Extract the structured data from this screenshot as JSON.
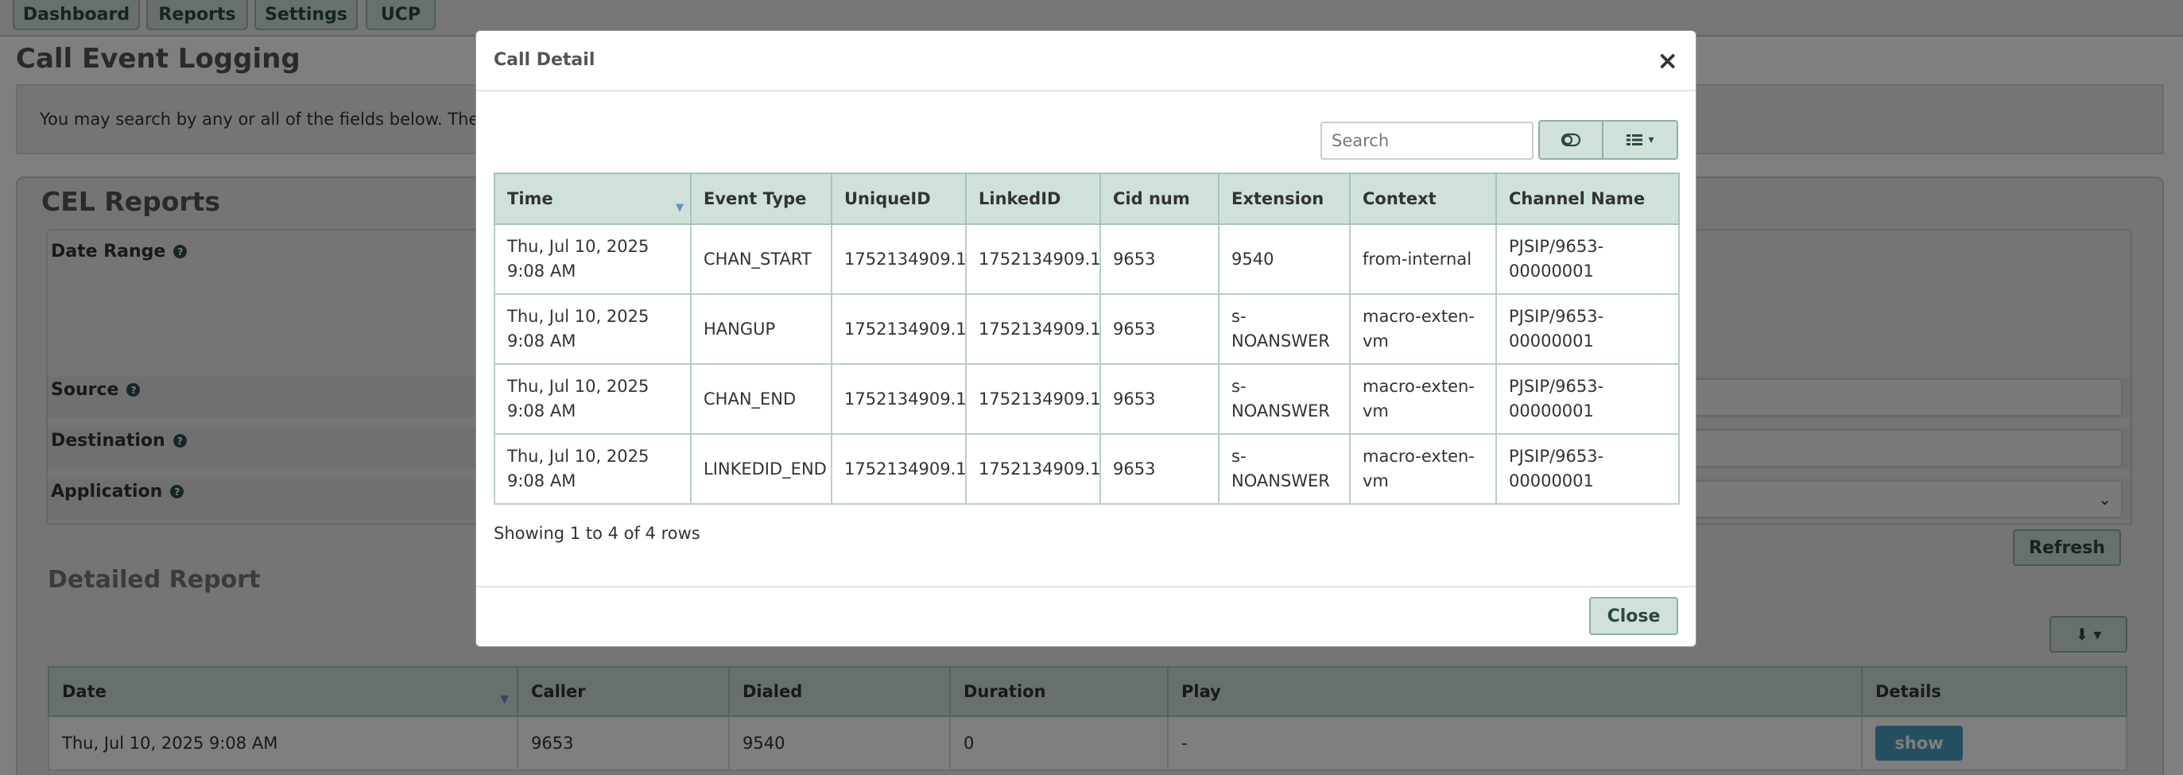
{
  "nav": {
    "items": [
      {
        "label": "Dashboard"
      },
      {
        "label": "Reports"
      },
      {
        "label": "Settings"
      },
      {
        "label": "UCP"
      }
    ]
  },
  "page": {
    "title": "Call Event Logging",
    "info_text": "You may search by any or all of the fields below. The mo"
  },
  "reports": {
    "title": "CEL Reports",
    "fields": {
      "date_range": "Date Range",
      "source": "Source",
      "destination": "Destination",
      "application": "Application"
    },
    "refresh_label": "Refresh",
    "detailed_title": "Detailed Report",
    "table": {
      "columns": [
        "Date",
        "Caller",
        "Dialed",
        "Duration",
        "Play",
        "Details"
      ],
      "rows": [
        {
          "date": "Thu, Jul 10, 2025 9:08 AM",
          "caller": "9653",
          "dialed": "9540",
          "duration": "0",
          "play": "-",
          "details": "show"
        }
      ]
    }
  },
  "modal": {
    "title": "Call Detail",
    "close_x": "×",
    "search_placeholder": "Search",
    "columns": [
      "Time",
      "Event Type",
      "UniqueID",
      "LinkedID",
      "Cid num",
      "Extension",
      "Context",
      "Channel Name"
    ],
    "rows": [
      {
        "time": "Thu, Jul 10, 2025 9:08 AM",
        "event": "CHAN_START",
        "uniqueid": "1752134909.1",
        "linkedid": "1752134909.1",
        "cid": "9653",
        "ext": "9540",
        "context": "from-internal",
        "channel": "PJSIP/9653-00000001"
      },
      {
        "time": "Thu, Jul 10, 2025 9:08 AM",
        "event": "HANGUP",
        "uniqueid": "1752134909.1",
        "linkedid": "1752134909.1",
        "cid": "9653",
        "ext": "s-NOANSWER",
        "context": "macro-exten-vm",
        "channel": "PJSIP/9653-00000001"
      },
      {
        "time": "Thu, Jul 10, 2025 9:08 AM",
        "event": "CHAN_END",
        "uniqueid": "1752134909.1",
        "linkedid": "1752134909.1",
        "cid": "9653",
        "ext": "s-NOANSWER",
        "context": "macro-exten-vm",
        "channel": "PJSIP/9653-00000001"
      },
      {
        "time": "Thu, Jul 10, 2025 9:08 AM",
        "event": "LINKEDID_END",
        "uniqueid": "1752134909.1",
        "linkedid": "1752134909.1",
        "cid": "9653",
        "ext": "s-NOANSWER",
        "context": "macro-exten-vm",
        "channel": "PJSIP/9653-00000001"
      }
    ],
    "rows_info": "Showing 1 to 4 of 4 rows",
    "close_label": "Close"
  },
  "icons": {
    "help": "question-circle-icon",
    "toggle": "toggle-icon",
    "columns": "list-columns-icon",
    "download": "download-icon",
    "close": "close-icon"
  },
  "colors": {
    "accent_green": "#cfe1d9",
    "accent_border": "#8fb0a2",
    "show_button": "#4a9ec2",
    "backdrop": "rgba(0,0,0,0.5)"
  }
}
